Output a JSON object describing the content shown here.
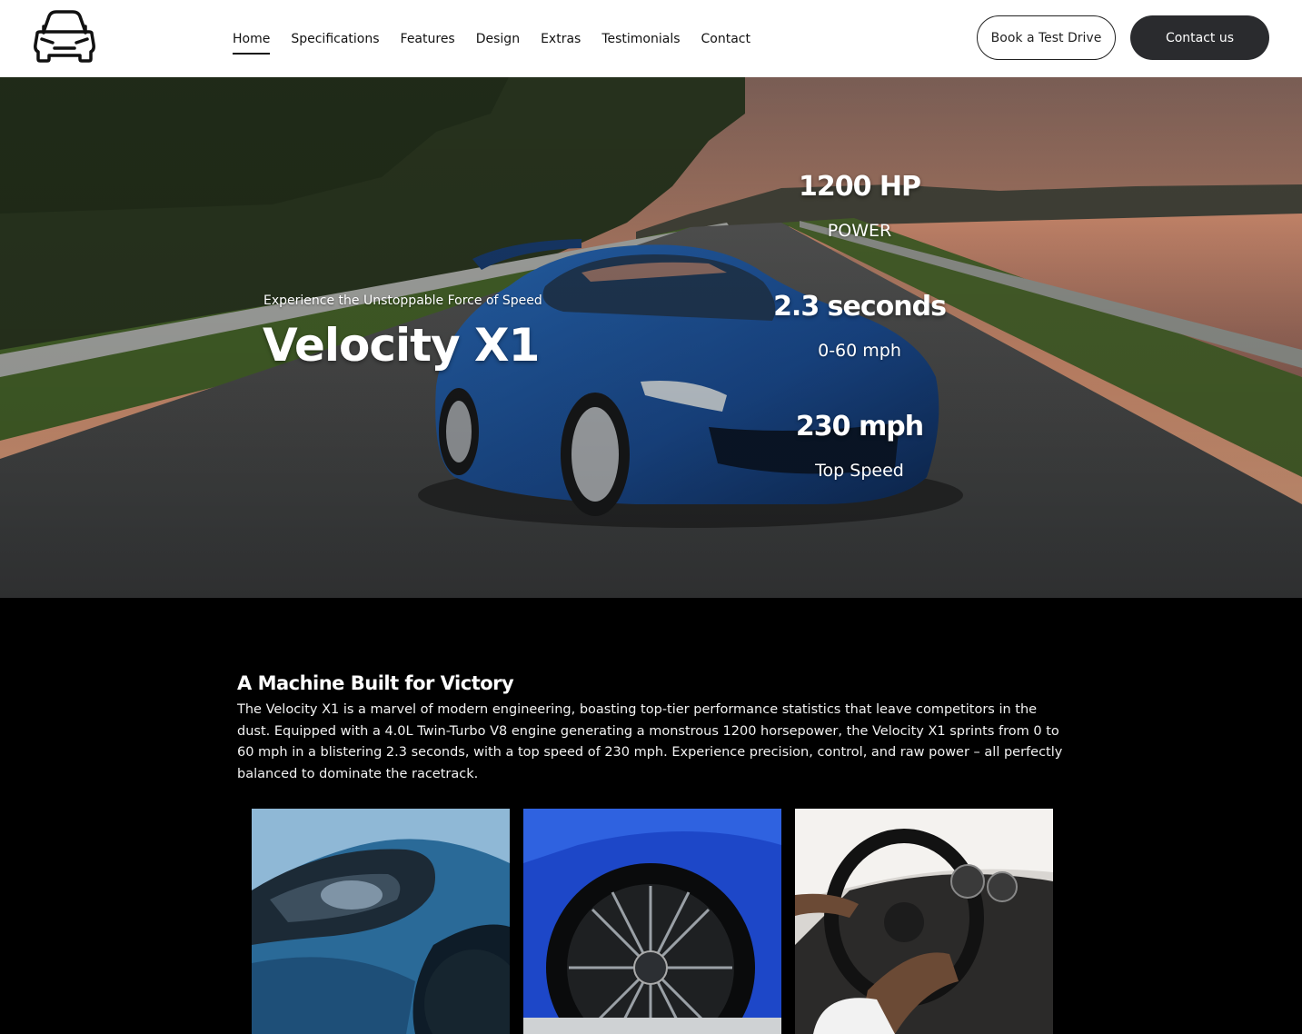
{
  "header": {
    "logo_icon": "car-front-icon",
    "nav": [
      {
        "label": "Home",
        "active": true
      },
      {
        "label": "Specifications"
      },
      {
        "label": "Features"
      },
      {
        "label": "Design"
      },
      {
        "label": "Extras"
      },
      {
        "label": "Testimonials"
      },
      {
        "label": "Contact"
      }
    ],
    "book_label": "Book a Test Drive",
    "contact_label": "Contact us"
  },
  "hero": {
    "tagline": "Experience the Unstoppable Force of Speed",
    "title": "Velocity X1",
    "stats": [
      {
        "value": "1200 HP",
        "label": "POWER"
      },
      {
        "value": "2.3 seconds",
        "label": "0-60 mph"
      },
      {
        "value": "230 mph",
        "label": "Top Speed"
      }
    ]
  },
  "section": {
    "title": "A Machine Built for Victory",
    "body": "The Velocity X1 is a marvel of modern engineering, boasting top-tier performance statistics that leave competitors in the dust. Equipped with a 4.0L Twin-Turbo V8 engine generating a monstrous 1200 horsepower, the Velocity X1 sprints from 0 to 60 mph in a blistering 2.3 seconds, with a top speed of 230 mph. Experience precision, control, and raw power – all perfectly balanced to dominate the racetrack."
  },
  "colors": {
    "header_bg": "#ffffff",
    "page_bg": "#000000",
    "button_dark": "#2a2b2e",
    "car_blue": "#1f5fae"
  }
}
